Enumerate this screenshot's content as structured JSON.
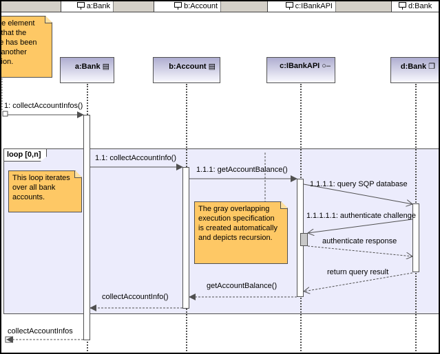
{
  "header_tabs": [
    {
      "label": "a:Bank",
      "icon": "lifeline-pin-icon"
    },
    {
      "label": "b:Account",
      "icon": "lifeline-pin-icon"
    },
    {
      "label": "c:IBankAPI",
      "icon": "lifeline-pin-icon"
    },
    {
      "label": "d:Bank",
      "icon": "lifeline-pin-icon"
    }
  ],
  "lifelines": [
    {
      "name": "a:Bank",
      "icon": "class-icon",
      "glyph": "▤"
    },
    {
      "name": "b:Account",
      "icon": "class-icon",
      "glyph": "▤"
    },
    {
      "name": "c:IBankAPI",
      "icon": "interface-icon",
      "glyph": "○–"
    },
    {
      "name": "d:Bank",
      "icon": "node-icon",
      "glyph": "❐"
    }
  ],
  "notes": {
    "top_left": [
      "ate element",
      "s that the",
      "ge has been",
      "y another",
      "ction."
    ],
    "loop_note": [
      "This loop iterates",
      "over all bank",
      "accounts."
    ],
    "recursion_note": [
      "The gray overlapping",
      "execution specification",
      "is created automatically",
      "and depicts recursion."
    ]
  },
  "loop": {
    "label": "loop [0,n]"
  },
  "messages": [
    {
      "id": "m1",
      "text": "1: collectAccountInfos()",
      "type": "sync"
    },
    {
      "id": "m2",
      "text": "1.1: collectAccountInfo()",
      "type": "sync"
    },
    {
      "id": "m3",
      "text": "1.1.1: getAccountBalance()",
      "type": "sync"
    },
    {
      "id": "m4",
      "text": "1.1.1.1: query SQP database",
      "type": "async"
    },
    {
      "id": "m5",
      "text": "1.1.1.1.1: authenticate challenge",
      "type": "async"
    },
    {
      "id": "m6",
      "text": "authenticate response",
      "type": "reply"
    },
    {
      "id": "m7",
      "text": "return query result",
      "type": "reply"
    },
    {
      "id": "m8",
      "text": "getAccountBalance()",
      "type": "reply"
    },
    {
      "id": "m9",
      "text": "collectAccountInfo()",
      "type": "reply"
    },
    {
      "id": "m10",
      "text": "collectAccountInfos",
      "type": "reply"
    }
  ],
  "colors": {
    "note_fill": "#fec865",
    "loop_fill": "#ececfc",
    "line": "#505050",
    "exec_recursion": "#c8c8c8"
  }
}
